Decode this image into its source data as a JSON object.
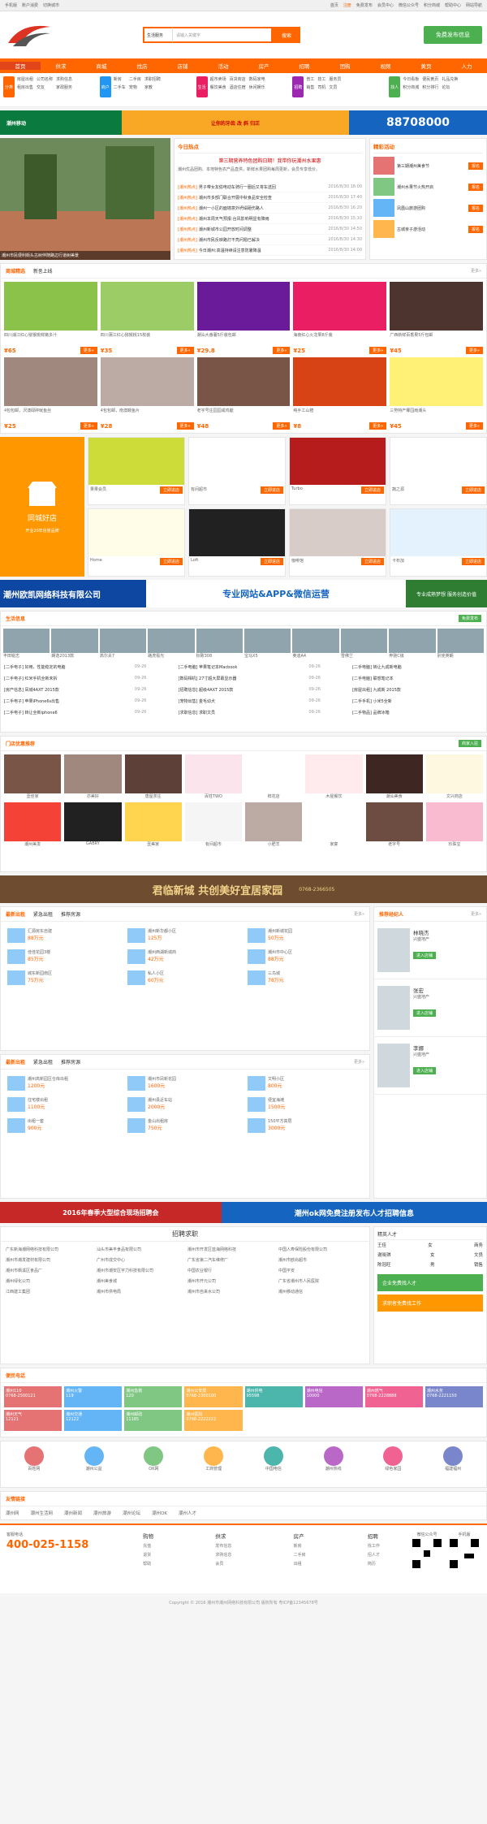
{
  "topbar": {
    "left": [
      "手机版",
      "账户消费",
      "切换城市"
    ],
    "right": [
      "首页",
      "注册",
      "免费发布",
      "会员中心",
      "微信公众号",
      "积分商城",
      "帮助中心",
      "网站导航"
    ],
    "login": "登录"
  },
  "header": {
    "search_select": "生活服务",
    "search_placeholder": "请输入关键字",
    "search_btn": "搜索",
    "post_btn": "免费发布信息"
  },
  "nav": [
    "首页",
    "供求",
    "商城",
    "找店",
    "店铺",
    "活动",
    "房产",
    "招聘",
    "团购",
    "视频",
    "黄页",
    "人力"
  ],
  "categories": [
    {
      "icon": "分类",
      "color": "#f60",
      "items": [
        "房屋出租",
        "公司名称",
        "求购信息",
        "租房出售",
        "交友",
        "家政服务"
      ]
    },
    {
      "icon": "商户",
      "color": "#2196f3",
      "items": [
        "新房",
        "二手房",
        "求职招聘",
        "二手车",
        "宠物",
        "家教"
      ]
    },
    {
      "icon": "生活",
      "color": "#e91e63",
      "items": [
        "超市卖场",
        "百货商店",
        "数码家电",
        "餐饮美食",
        "酒店住宿",
        "休闲娱乐"
      ]
    },
    {
      "icon": "招聘",
      "color": "#9c27b0",
      "items": [
        "普工",
        "技工",
        "服务员",
        "销售",
        "司机",
        "文员"
      ]
    },
    {
      "icon": "找人",
      "color": "#4caf50",
      "items": [
        "今日看板",
        "便民黄页",
        "礼品兑换",
        "积分商城",
        "积分排行",
        "论坛"
      ]
    }
  ],
  "banner1": {
    "left": "潮州移动",
    "mid": "让你的牙齿 改 斜 归正",
    "phone": "88708000"
  },
  "hot": {
    "title": "今日热点",
    "headline": "第三期营养特色团购日期！我带你玩潮州水果惠",
    "summary": "潮州优品团购、本地特色农产品直供，新鲜水果团购每周更新，会员专享低价。",
    "list": [
      {
        "t": "[潮州热点]",
        "s": "男子带女友偷电动车骑行一圈后又将车送回",
        "d": "2016/8/30 18:00"
      },
      {
        "t": "[潮州热点]",
        "s": "潮州市多部门联合开展中秋食品安全检查",
        "d": "2016/8/30 17:40"
      },
      {
        "t": "[潮州热点]",
        "s": "潮州一小区的面墙意外坍塌砸伤路人",
        "d": "2016/8/30 16:20"
      },
      {
        "t": "[潮州热点]",
        "s": "潮州本周天气预报:台风影响明显有降雨",
        "d": "2016/8/30 15:10"
      },
      {
        "t": "[潮州热点]",
        "s": "潮州新城市公园开放时间调整",
        "d": "2016/8/30 14:50"
      },
      {
        "t": "[潮州热点]",
        "s": "潮州市民反映路灯不亮问题已解决",
        "d": "2016/8/30 14:30"
      },
      {
        "t": "[潮州热点]",
        "s": "今日潮州:高温持续请注意防暑降温",
        "d": "2016/8/30 14:00"
      }
    ],
    "photo_caption": "潮州市民便利街头古树伴随路边行道树美景"
  },
  "side_activity": {
    "title": "精彩活动",
    "items": [
      {
        "n": "第三期潮州美食节",
        "v": "报名"
      },
      {
        "n": "潮州水果节火热开启",
        "v": "报名"
      },
      {
        "n": "凤凰山旅游团购",
        "v": "报名"
      },
      {
        "n": "古城亲子游活动",
        "v": "报名"
      }
    ]
  },
  "goods": {
    "tabs": [
      "商城精选",
      "新품上线"
    ],
    "more": "更多»",
    "items": [
      {
        "n": "四川浦江红心猕猴桃鲜嫩多汁",
        "p": "¥65"
      },
      {
        "n": "四川蒲江红心猕猴桃15枚装",
        "p": "¥35"
      },
      {
        "n": "潮汕大番薯5斤装包邮",
        "p": "¥29.8"
      },
      {
        "n": "海南红心火龙果8斤装",
        "p": "¥25"
      },
      {
        "n": "广西新鲜百香果5斤包邮",
        "p": "¥45"
      },
      {
        "n": "4包包邮，沢澳碌碎鱿鱼丝",
        "p": "¥25"
      },
      {
        "n": "4包包邮，南澳鳗鱼片",
        "p": "¥28"
      },
      {
        "n": "老字号庄园园咸鸡腿",
        "p": "¥48"
      },
      {
        "n": "纯手工山楂",
        "p": "¥8"
      },
      {
        "n": "三势特产椰园雨潮头",
        "p": "¥45"
      }
    ]
  },
  "shops": {
    "title": "同城好店",
    "items": [
      "果果会员",
      "有间超市",
      "Turbo",
      "蔬之源",
      "Home",
      "Loft",
      "咖啡馆",
      "卡布加"
    ],
    "btn": "立即进店",
    "sub": "开业20年信誉品牌"
  },
  "ad1": {
    "company": "潮州欧凯网络科技有限公司",
    "service": "专业网站&APP&微信运营",
    "slogan": "专业成熟梦想 服务创造价值"
  },
  "life": {
    "title": "生活信息",
    "more": "免费发布",
    "cars": [
      "丰田锐志",
      "朗逸2013款",
      "高尔夫7",
      "路虎极光",
      "标致308",
      "宝马X5",
      "奥迪A4",
      "雪佛兰",
      "奔驰C级",
      "别克英朗"
    ],
    "list": [
      [
        "[二手电子] 好用，性能稳定的电脑",
        "09-26",
        "[二手电脑] 苹果笔记本Macbook",
        "09-26",
        "[二手电脑] 转让九成新电脑"
      ],
      [
        "[二手电子] 红米手机全新未拆",
        "09-26",
        "[数码相机] 27寸超大屏幕显示器",
        "09-26",
        "[二手电脑] 联想笔记本"
      ],
      [
        "[房产信息] 凤城4AXT 2015款",
        "09-26",
        "[招聘信息] 超级4AXT 2015款",
        "09-26",
        "[房屋出租] 九成新 2015款"
      ],
      [
        "[二手电子] 苹果iPhone6s出售",
        "09-26",
        "[宠物出售] 金毛幼犬",
        "09-26",
        "[二手手机] 小米5全新"
      ],
      [
        "[二手电子] 转让全新iphone6",
        "09-26",
        "[求职信息] 求职文员",
        "09-26",
        "[二手物品] 品牌冰箱"
      ]
    ]
  },
  "mall": {
    "title": "门店优惠推荐",
    "more": "商家入驻",
    "shops": [
      "壹佳家",
      "亦美好",
      "唐屋茶庄",
      "百姓TWO",
      "鲜花店",
      "木屋餐饮",
      "潮汕美食",
      "文兴商店",
      "潮州美发",
      "GABRY",
      "壹美家",
      "有间超市",
      "小肥羊",
      "家宴",
      "老字号",
      "珍珠宝"
    ]
  },
  "ad2": {
    "text": "君临新城 共创美好宜居家园",
    "tel": "0768-2366505"
  },
  "house": {
    "tabs": [
      "最新出租",
      "紧急出租",
      "推荐房源"
    ],
    "more": "更多»",
    "list": [
      {
        "n": "汇源房东自建",
        "p": "88万元"
      },
      {
        "n": "潮州新华都小区",
        "p": "125万"
      },
      {
        "n": "潮州新城花园",
        "p": "50万元"
      },
      {
        "n": "佳佳花园3楼",
        "p": "85万元"
      },
      {
        "n": "潮州西湖新城商",
        "p": "42万元"
      },
      {
        "n": "潮州市中心区",
        "p": "88万元"
      },
      {
        "n": "城东新园南区",
        "p": "75万元"
      },
      {
        "n": "私人小区",
        "p": "60万元"
      },
      {
        "n": "三鸟城",
        "p": "78万元"
      }
    ]
  },
  "rent": {
    "tabs": [
      "最新出租",
      "紧急出租",
      "推荐房源"
    ],
    "more": "更多»",
    "list": [
      {
        "n": "潮州高新园区仓库出租",
        "p": "1200元"
      },
      {
        "n": "潮州市凤新花园",
        "p": "1600元"
      },
      {
        "n": "文明小区",
        "p": "800元"
      },
      {
        "n": "住宅楼出租",
        "p": "1100元"
      },
      {
        "n": "潮州县近车站",
        "p": "2000元"
      },
      {
        "n": "便宜海滩",
        "p": "1500元"
      },
      {
        "n": "出租一套",
        "p": "900元"
      },
      {
        "n": "金山出租房",
        "p": "750元"
      },
      {
        "n": "150平方高层",
        "p": "3000元"
      }
    ]
  },
  "agents": {
    "title": "推荐经纪人",
    "more": "更多»",
    "items": [
      {
        "n": "林晓杰",
        "co": "兴盛地产",
        "btn": "进入店铺"
      },
      {
        "n": "张宏",
        "co": "兴盛地产",
        "btn": "进入店铺"
      },
      {
        "n": "李娜",
        "co": "兴盛地产",
        "btn": "进入店铺"
      }
    ]
  },
  "ad3": {
    "left": "2016年春季大型综合现场招聘会",
    "right": "潮州ok网免费注册发布人才招聘信息"
  },
  "jobs": {
    "title": "招聘求职",
    "companies": [
      "广东新海潮网络科技有限公司",
      "汕头市美丰食品有限公司",
      "潮州市开发区蓝海网络科技",
      "中国人寿保险股份有限公司",
      "潮州市潮发建材有限公司",
      "广州市成交中心",
      "广东省第二汽车维修厂",
      "潮州市欧尚超市",
      "潮州市枫溪区食品厂",
      "潮州市潮安区宇力科技有限公司",
      "中国农业银行",
      "中国平安",
      "潮州绿化公司",
      "潮州美食城",
      "潮州市开元公司",
      "广东省潮州市人民医院",
      "江西建工集团",
      "潮州市供电局",
      "潮州市自来水公司",
      "潮州移动通信"
    ],
    "talent": {
      "title": "精英人才",
      "items": [
        [
          "王佳",
          "女",
          "商务"
        ],
        [
          "谢晓琪",
          "女",
          "文员"
        ],
        [
          "陈冠旺",
          "男",
          "销售"
        ]
      ]
    },
    "btn1": "企业免费找人才",
    "btn2": "求职者免费找工作"
  },
  "phones": {
    "title": "便民电话",
    "items": [
      [
        "潮州110",
        "0768-2500121"
      ],
      [
        "潮州火警",
        "119"
      ],
      [
        "潮州急救",
        "120"
      ],
      [
        "潮州公安局",
        "0768-2300100"
      ],
      [
        "潮州供电",
        "95598"
      ],
      [
        "潮州电信",
        "10000"
      ],
      [
        "潮州燃气",
        "0768-2228888"
      ],
      [
        "潮州水务",
        "0768-2221150"
      ],
      [
        "潮州天气",
        "12121"
      ],
      [
        "潮州交通",
        "12122"
      ],
      [
        "潮州邮政",
        "11185"
      ],
      [
        "潮州医院",
        "0768-2222222"
      ]
    ]
  },
  "links": {
    "title": "友情链接",
    "items": [
      "潮州网",
      "潮州生活网",
      "潮州新闻",
      "潮州旅游",
      "潮州论坛",
      "潮州OK",
      "潮州人才"
    ],
    "logos": [
      "百姓网",
      "潮州公益",
      "OK网",
      "工商管理",
      "中国电信",
      "潮州热线",
      "绿色家园",
      "福建福州"
    ]
  },
  "footer": {
    "tel_label": "客服电话",
    "tel": "400-025-1158",
    "cols": [
      [
        "购物",
        "充值",
        "退货",
        "帮助"
      ],
      [
        "供求",
        "发布信息",
        "求购信息",
        "会员"
      ],
      [
        "房产",
        "新房",
        "二手房",
        "出租"
      ],
      [
        "招聘",
        "找工作",
        "招人才",
        "简历"
      ]
    ],
    "copy": "Copyright © 2016 潮州市潮州网络科技有限公司 版权所有 粤ICP备12345678号",
    "qr1": "微信公众号",
    "qr2": "手机版"
  }
}
